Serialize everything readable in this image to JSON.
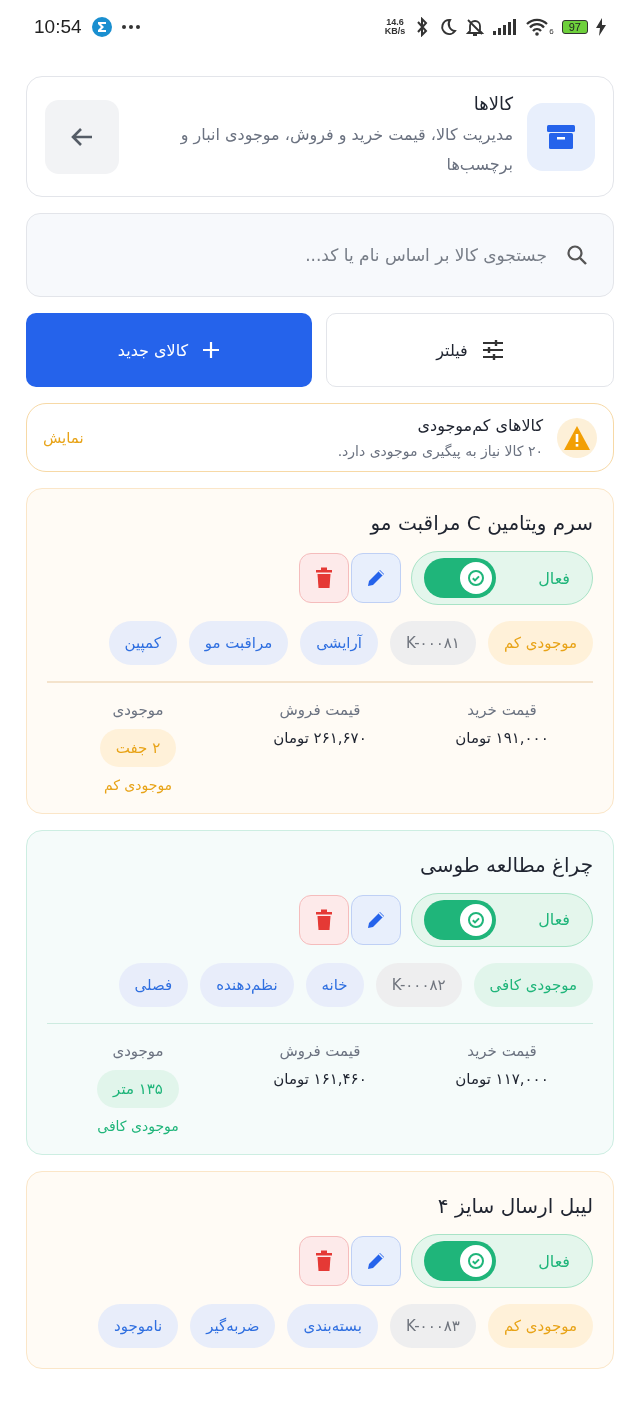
{
  "status_bar": {
    "time": "10:54",
    "net_speed": "14.6",
    "net_unit": "KB/s",
    "wifi_label": "6",
    "battery": "97"
  },
  "header": {
    "title": "کالاها",
    "subtitle": "مدیریت کالا، قیمت خرید و فروش، موجودی انبار و برچسب‌ها"
  },
  "search": {
    "placeholder": "جستجوی کالا بر اساس نام یا کد..."
  },
  "actions": {
    "filter": "فیلتر",
    "new_item": "کالای جدید"
  },
  "alert": {
    "title": "کالاهای کم‌موجودی",
    "message": "۲۰ کالا نیاز به پیگیری موجودی دارد.",
    "action": "نمایش"
  },
  "products": [
    {
      "name": "سرم ویتامین C مراقبت مو",
      "kind": "low",
      "active_label": "فعال",
      "on": true,
      "tags": [
        {
          "kind": "status",
          "label": "موجودی کم"
        },
        {
          "kind": "sku",
          "label": "K-۰۰۰۸۱"
        },
        {
          "kind": "category",
          "label": "آرایشی"
        },
        {
          "kind": "category",
          "label": "مراقبت مو"
        },
        {
          "kind": "category",
          "label": "کمپین"
        }
      ],
      "stats": [
        {
          "label": "قیمت خرید",
          "value": "۱۹۱,۰۰۰ تومان"
        },
        {
          "label": "قیمت فروش",
          "value": "۲۶۱,۶۷۰ تومان"
        }
      ],
      "stock": {
        "label": "موجودی",
        "value": "۲ جفت",
        "note": "موجودی کم"
      }
    },
    {
      "name": "چراغ مطالعه طوسی",
      "kind": "ok",
      "active_label": "فعال",
      "on": true,
      "tags": [
        {
          "kind": "status",
          "label": "موجودی کافی"
        },
        {
          "kind": "sku",
          "label": "K-۰۰۰۸۲"
        },
        {
          "kind": "category",
          "label": "خانه"
        },
        {
          "kind": "category",
          "label": "نظم‌دهنده"
        },
        {
          "kind": "category",
          "label": "فصلی"
        }
      ],
      "stats": [
        {
          "label": "قیمت خرید",
          "value": "۱۱۷,۰۰۰ تومان"
        },
        {
          "label": "قیمت فروش",
          "value": "۱۶۱,۴۶۰ تومان"
        }
      ],
      "stock": {
        "label": "موجودی",
        "value": "۱۳۵ متر",
        "note": "موجودی کافی"
      }
    },
    {
      "name": "لیبل ارسال سایز ۴",
      "kind": "low",
      "active_label": "فعال",
      "on": true,
      "tags": [
        {
          "kind": "status",
          "label": "موجودی کم"
        },
        {
          "kind": "sku",
          "label": "K-۰۰۰۸۳"
        },
        {
          "kind": "category",
          "label": "بسته‌بندی"
        },
        {
          "kind": "category",
          "label": "ضربه‌گیر"
        },
        {
          "kind": "category",
          "label": "ناموجود"
        }
      ]
    }
  ]
}
